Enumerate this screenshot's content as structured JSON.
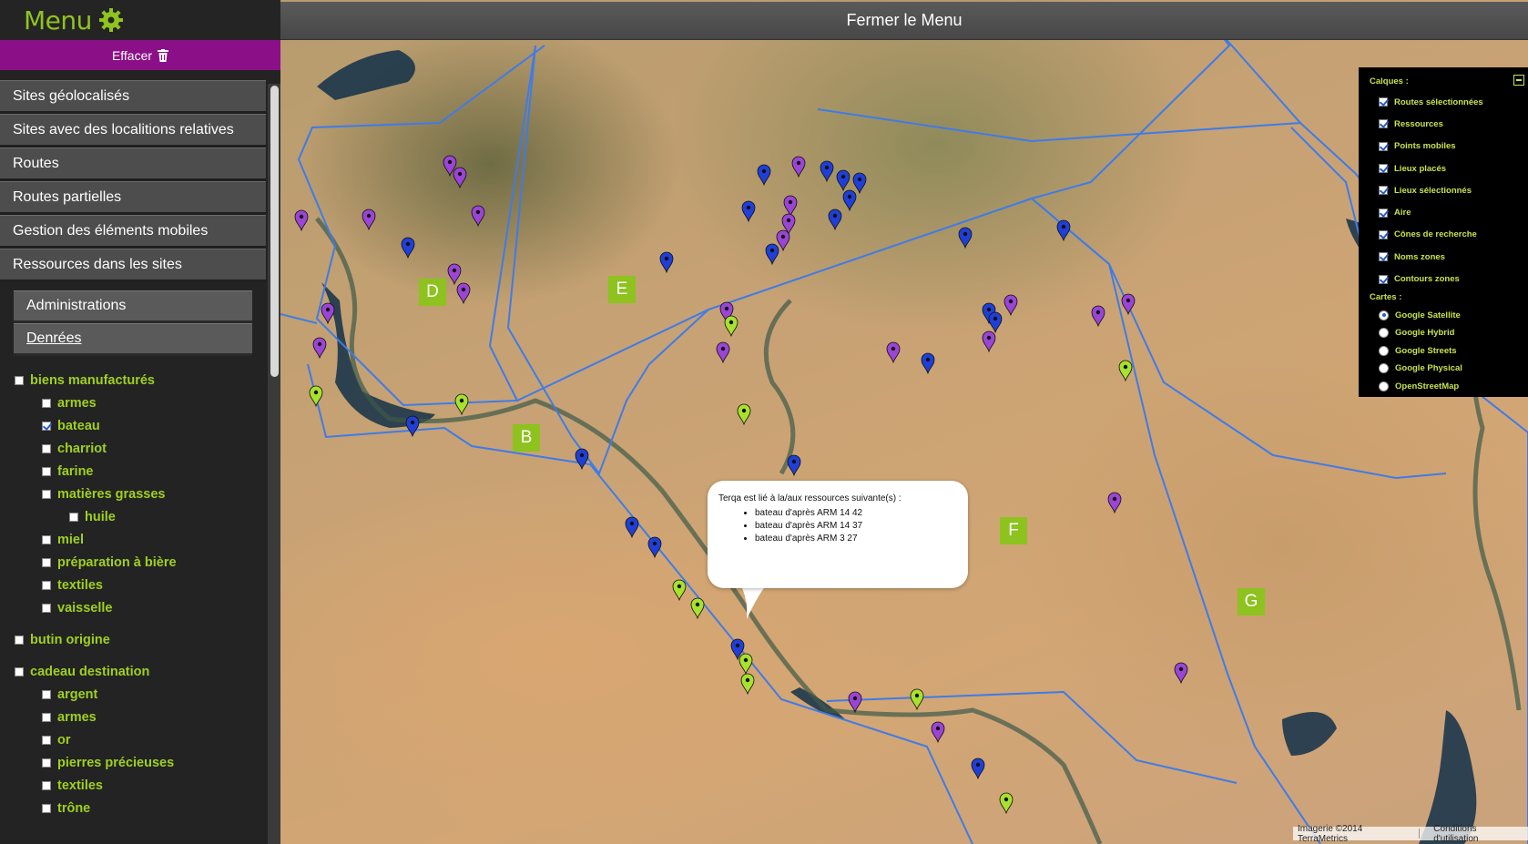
{
  "sidebar": {
    "menu_title": "Menu",
    "clear_label": "Effacer",
    "nav_items": [
      {
        "label": "Sites géolocalisés"
      },
      {
        "label": "Sites avec des localitions relatives"
      },
      {
        "label": "Routes"
      },
      {
        "label": "Routes partielles"
      },
      {
        "label": "Gestion des éléments mobiles"
      },
      {
        "label": "Ressources dans les sites"
      }
    ],
    "sub_items": [
      {
        "label": "Administrations"
      },
      {
        "label": "Denrées"
      }
    ],
    "tree": [
      {
        "label": "biens manufacturés",
        "level": 0,
        "checked": false
      },
      {
        "label": "armes",
        "level": 1,
        "checked": false
      },
      {
        "label": "bateau",
        "level": 1,
        "checked": true
      },
      {
        "label": "charriot",
        "level": 1,
        "checked": false
      },
      {
        "label": "farine",
        "level": 1,
        "checked": false
      },
      {
        "label": "matières grasses",
        "level": 1,
        "checked": false
      },
      {
        "label": "huile",
        "level": 2,
        "checked": false
      },
      {
        "label": "miel",
        "level": 1,
        "checked": false
      },
      {
        "label": "préparation à bière",
        "level": 1,
        "checked": false
      },
      {
        "label": "textiles",
        "level": 1,
        "checked": false
      },
      {
        "label": "vaisselle",
        "level": 1,
        "checked": false
      },
      {
        "label": "butin origine",
        "level": 0,
        "checked": false
      },
      {
        "label": "cadeau destination",
        "level": 0,
        "checked": false
      },
      {
        "label": "argent",
        "level": 1,
        "checked": false
      },
      {
        "label": "armes",
        "level": 1,
        "checked": false
      },
      {
        "label": "or",
        "level": 1,
        "checked": false
      },
      {
        "label": "pierres précieuses",
        "level": 1,
        "checked": false
      },
      {
        "label": "textiles",
        "level": 1,
        "checked": false
      },
      {
        "label": "trône",
        "level": 1,
        "checked": false
      }
    ]
  },
  "map": {
    "close_menu_label": "Fermer le Menu",
    "zones": [
      "D",
      "E",
      "B",
      "F",
      "G"
    ],
    "popup": {
      "intro": "Terqa est lié à la/aux ressources suivante(s) :",
      "items": [
        "bateau d'après ARM 14 42",
        "bateau d'après ARM 14 37",
        "bateau d'après ARM 3 27"
      ]
    },
    "layers": {
      "title": "Calques :",
      "items": [
        "Routes sélectionnées",
        "Ressources",
        "Points mobiles",
        "Lieux placés",
        "Lieux sélectionnés",
        "Aire",
        "Cônes de recherche",
        "Noms zones",
        "Contours zones"
      ],
      "maps_title": "Cartes :",
      "maps": [
        "Google Satellite",
        "Google Hybrid",
        "Google Streets",
        "Google Physical",
        "OpenStreetMap"
      ],
      "selected_map": "Google Satellite"
    },
    "attribution": "Imagerie ©2014 TerraMetrics",
    "terms": "Conditions d'utilisation",
    "colors": {
      "purple_marker": "#9b44d6",
      "blue_marker": "#1f3fd8",
      "green_marker": "#a6e22e",
      "zone_line": "#3f7be8",
      "zone_label": "#8dc21f",
      "accent": "#8b0f86"
    }
  }
}
